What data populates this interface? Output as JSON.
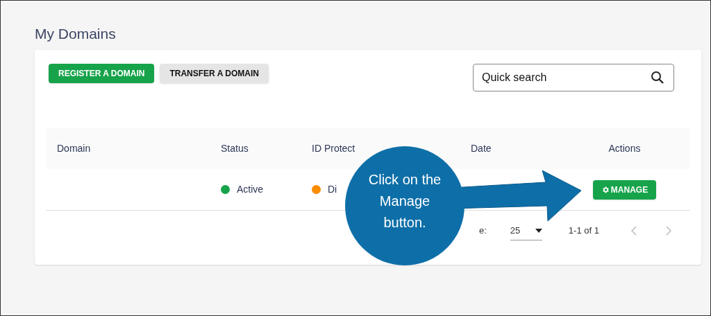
{
  "page": {
    "title": "My Domains"
  },
  "toolbar": {
    "buttons": [
      {
        "label": "REGISTER A DOMAIN",
        "kind": "primary"
      },
      {
        "label": "TRANSFER A DOMAIN",
        "kind": "secondary"
      }
    ],
    "search": {
      "placeholder": "Quick search"
    }
  },
  "table": {
    "columns": [
      "Domain",
      "Status",
      "ID Protect",
      "Date",
      "Actions"
    ],
    "rows": [
      {
        "status": {
          "label": "Active",
          "color": "#16a34a"
        },
        "id_protect": {
          "label": "Di",
          "color": "#fb8c00"
        },
        "action": "MANAGE"
      }
    ]
  },
  "pagination": {
    "label": "e:",
    "per_page": "25",
    "range": "1-1 of 1"
  },
  "callout": {
    "text": "Click on the Manage button."
  }
}
